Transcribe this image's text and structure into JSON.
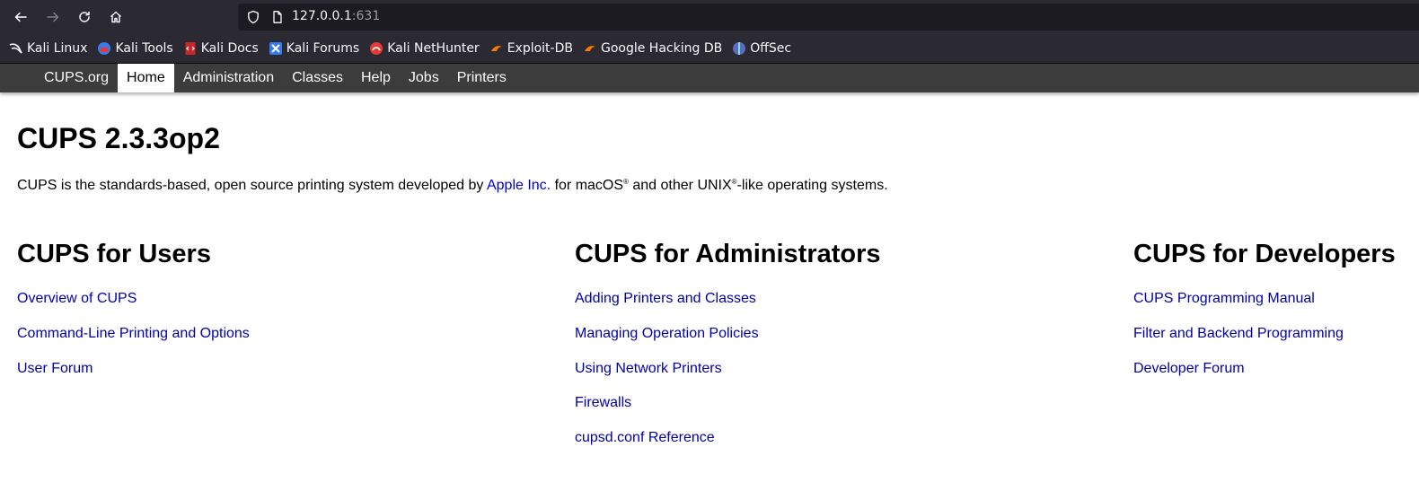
{
  "browser": {
    "url_host": "127.0.0.1",
    "url_port": ":631",
    "bookmarks": [
      {
        "label": "Kali Linux",
        "icon": "kali-dragon-icon"
      },
      {
        "label": "Kali Tools",
        "icon": "kali-tools-icon"
      },
      {
        "label": "Kali Docs",
        "icon": "kali-docs-icon"
      },
      {
        "label": "Kali Forums",
        "icon": "kali-forums-icon"
      },
      {
        "label": "Kali NetHunter",
        "icon": "kali-nethunter-icon"
      },
      {
        "label": "Exploit-DB",
        "icon": "exploit-db-icon"
      },
      {
        "label": "Google Hacking DB",
        "icon": "ghdb-icon"
      },
      {
        "label": "OffSec",
        "icon": "offsec-icon"
      }
    ]
  },
  "cups_nav": {
    "items": [
      "CUPS.org",
      "Home",
      "Administration",
      "Classes",
      "Help",
      "Jobs",
      "Printers"
    ],
    "active": "Home"
  },
  "main": {
    "title": "CUPS 2.3.3op2",
    "intro_before": "CUPS is the standards-based, open source printing system developed by ",
    "intro_link": "Apple Inc.",
    "intro_mid": " for macOS",
    "intro_reg1": "®",
    "intro_mid2": " and other UNIX",
    "intro_reg2": "®",
    "intro_after": "-like operating systems."
  },
  "columns": [
    {
      "heading": "CUPS for Users",
      "links": [
        "Overview of CUPS",
        "Command-Line Printing and Options",
        "User Forum"
      ]
    },
    {
      "heading": "CUPS for Administrators",
      "links": [
        "Adding Printers and Classes",
        "Managing Operation Policies",
        "Using Network Printers",
        "Firewalls",
        "cupsd.conf Reference"
      ]
    },
    {
      "heading": "CUPS for Developers",
      "links": [
        "CUPS Programming Manual",
        "Filter and Backend Programming",
        "Developer Forum"
      ]
    }
  ],
  "colors": {
    "chrome_bg": "#2b2a33",
    "urlbar_bg": "#1c1b22",
    "nav_bg": "#3c3c3c",
    "link": "#0000aa"
  }
}
